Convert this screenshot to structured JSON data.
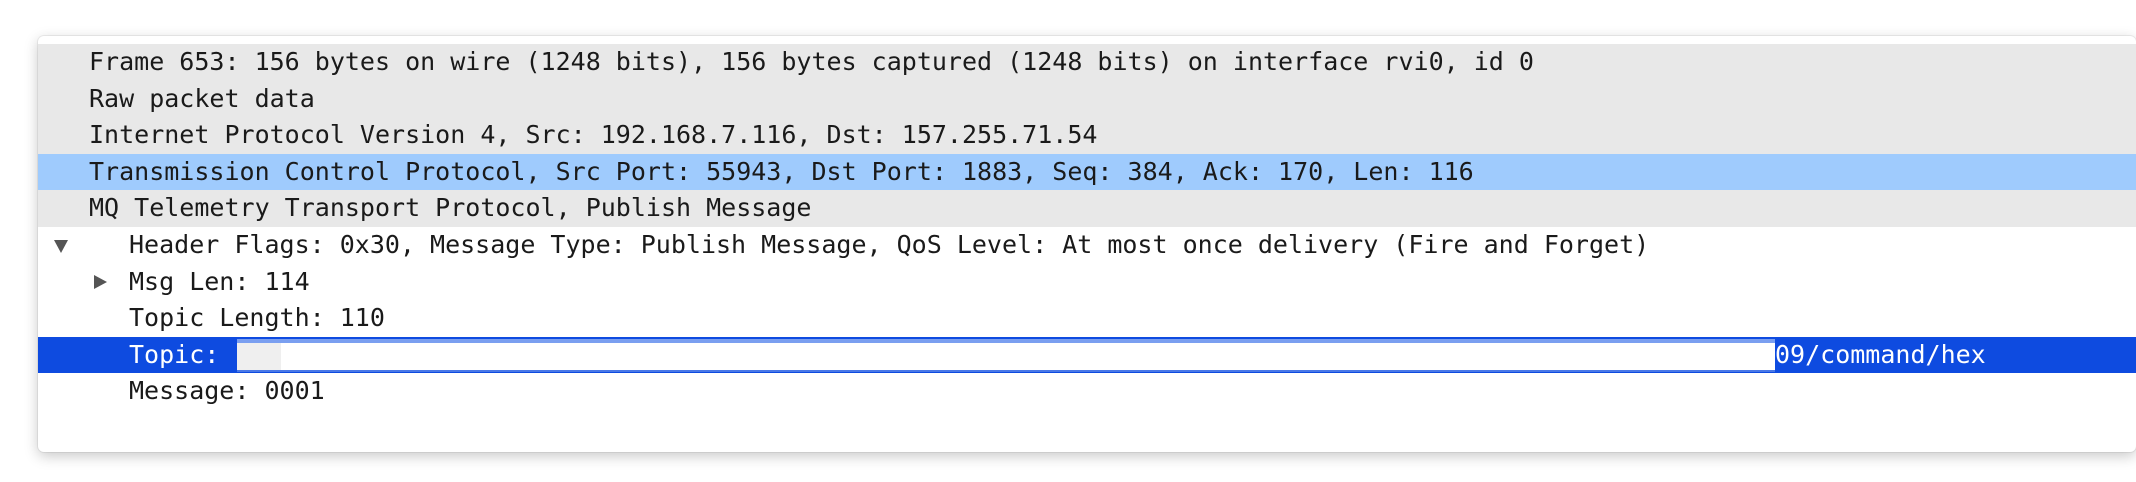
{
  "tree": {
    "frame": "Frame 653: 156 bytes on wire (1248 bits), 156 bytes captured (1248 bits) on interface rvi0, id 0",
    "raw": "Raw packet data",
    "ip": "Internet Protocol Version 4, Src: 192.168.7.116, Dst: 157.255.71.54",
    "tcp": "Transmission Control Protocol, Src Port: 55943, Dst Port: 1883, Seq: 384, Ack: 170, Len: 116",
    "mqtt": "MQ Telemetry Transport Protocol, Publish Message",
    "header_flags": "Header Flags: 0x30, Message Type: Publish Message, QoS Level: At most once delivery (Fire and Forget)",
    "msg_len": "Msg Len: 114",
    "topic_length": "Topic Length: 110",
    "topic_label": "Topic:",
    "topic_tail": "09/command/hex",
    "message": "Message: 0001"
  },
  "icons": {
    "collapsed": "triangle-right-icon",
    "expanded": "triangle-down-icon"
  },
  "colors": {
    "row_gray": "#e8e8e8",
    "selection_light": "#9fcbfd",
    "selection_dark": "#0e4be0"
  }
}
